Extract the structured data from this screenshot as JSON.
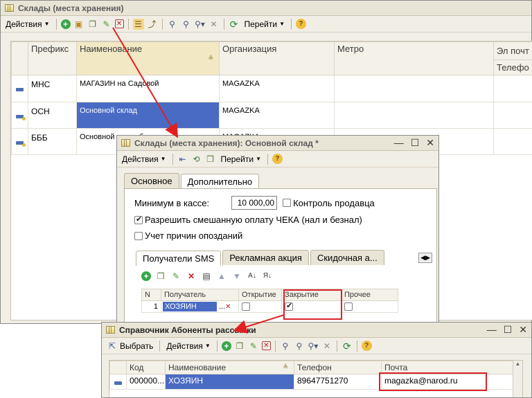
{
  "main_window": {
    "title": "Склады (места хранения)",
    "toolbar": {
      "actions_label": "Действия",
      "goto_label": "Перейти"
    },
    "columns": [
      "Префикс",
      "Наименование",
      "Организация",
      "Метро",
      "Эл почт",
      "Телефо"
    ],
    "rows": [
      {
        "prefix": "МНС",
        "name": "МАГАЗИН на Садовой",
        "org": "MAGAZKA"
      },
      {
        "prefix": "ОСН",
        "name": "Основной склад",
        "org": "MAGAZKA"
      },
      {
        "prefix": "БББ",
        "name": "Основной склад брака",
        "org": "MAGAZKA"
      }
    ]
  },
  "detail_window": {
    "title": "Склады (места хранения): Основной склад *",
    "toolbar": {
      "actions_label": "Действия",
      "goto_label": "Перейти"
    },
    "tabs": [
      "Основное",
      "Дополнительно"
    ],
    "min_cash_label": "Минимум в кассе:",
    "min_cash_value": "10 000,00",
    "seller_control_label": "Контроль продавца",
    "mixed_payment_label": "Разрешить смешанную оплату ЧЕКА (нал и безнал)",
    "late_reasons_label": "Учет причин опозданий",
    "subtabs": [
      "Получатели SMS",
      "Рекламная акция",
      "Скидочная а..."
    ],
    "recipients_columns": [
      "N",
      "Получатель",
      "Открытие",
      "Закрытие",
      "Прочее"
    ],
    "recipients_rows": [
      {
        "n": "1",
        "recipient": "ХОЗЯИН",
        "open": false,
        "close": true,
        "other": false
      }
    ]
  },
  "subscribers_window": {
    "title": "Справочник Абоненты рассылки",
    "toolbar": {
      "select_label": "Выбрать",
      "actions_label": "Действия"
    },
    "columns": [
      "Код",
      "Наименование",
      "Телефон",
      "Почта"
    ],
    "rows": [
      {
        "code": "000000...",
        "name": "ХОЗЯИН",
        "phone": "89647751270",
        "email": "magazka@narod.ru"
      }
    ]
  },
  "colors": {
    "selection": "#4a6bc4",
    "highlight_box": "#d8232a",
    "arrow": "#e02020"
  }
}
